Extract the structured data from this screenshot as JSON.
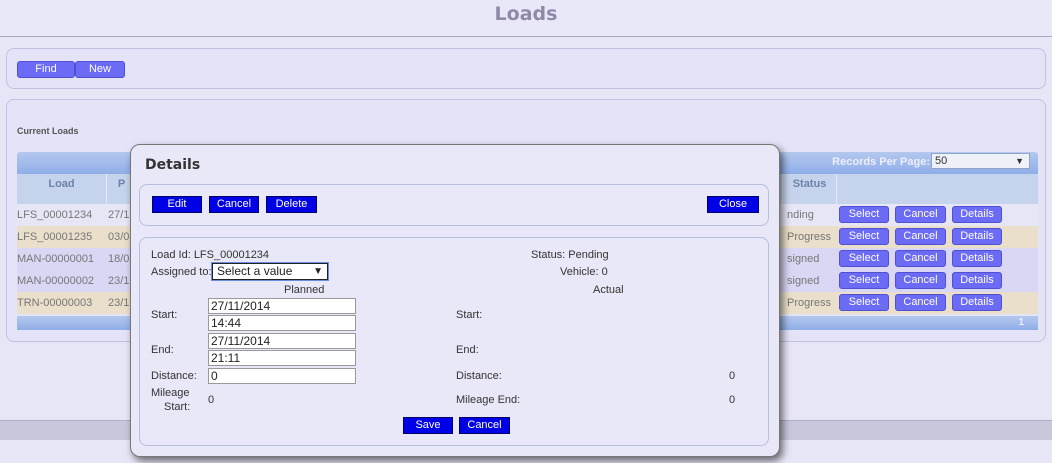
{
  "page": {
    "title": "Loads"
  },
  "toolbar": {
    "find": "Find",
    "new": "New"
  },
  "loads": {
    "section_label": "Current Loads",
    "records_per_page_label": "Records Per Page:",
    "records_per_page_value": "50",
    "columns": {
      "load": "Load",
      "planned_start_partial": "P",
      "status": "Status"
    },
    "rows": [
      {
        "load": "LFS_00001234",
        "date": "27/1",
        "status": "nding",
        "style": "row-a"
      },
      {
        "load": "LFS_00001235",
        "date": "03/0",
        "status": "Progress",
        "style": "row-b"
      },
      {
        "load": "MAN-00000001",
        "date": "18/0",
        "status": "signed",
        "style": "row-c"
      },
      {
        "load": "MAN-00000002",
        "date": "23/1",
        "status": "signed",
        "style": "row-c"
      },
      {
        "load": "TRN-00000003",
        "date": "23/1",
        "status": "Progress",
        "style": "row-b"
      }
    ],
    "row_actions": {
      "select": "Select",
      "cancel": "Cancel",
      "details": "Details"
    },
    "page_number": "1"
  },
  "details": {
    "title": "Details",
    "buttons": {
      "edit": "Edit",
      "cancel": "Cancel",
      "delete": "Delete",
      "close": "Close",
      "save": "Save",
      "cancel_bottom": "Cancel"
    },
    "load_id": "Load Id: LFS_00001234",
    "assigned_to_label": "Assigned to:",
    "assigned_to_value": "Select a value",
    "status": "Status: Pending",
    "vehicle": "Vehicle: 0",
    "planned_heading": "Planned",
    "actual_heading": "Actual",
    "start_label": "Start:",
    "end_label": "End:",
    "distance_label": "Distance:",
    "mileage_start_label_1": "Mileage",
    "mileage_start_label_2": "Start:",
    "mileage_end_label": "Mileage End:",
    "planned_start_date": "27/11/2014",
    "planned_start_time": "14:44",
    "planned_end_date": "27/11/2014",
    "planned_end_time": "21:11",
    "planned_distance": "0",
    "mileage_start_value": "0",
    "actual_distance": "0",
    "mileage_end_value": "0"
  }
}
